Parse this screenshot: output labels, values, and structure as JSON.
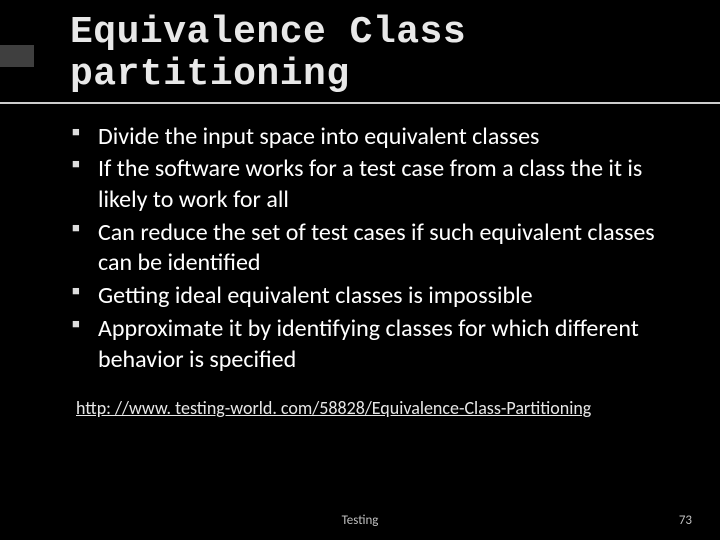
{
  "title": "Equivalence Class partitioning",
  "bullets": [
    "Divide the input space into equivalent classes",
    "If  the software works for a test case from a class the it is likely to work for all",
    "Can reduce the set of test cases if such equivalent classes can be identified",
    "Getting ideal  equivalent classes is  impossible",
    "Approximate it by identifying classes for which different behavior is specified"
  ],
  "link": "http: //www. testing-world. com/58828/Equivalence-Class-Partitioning",
  "footer": {
    "center": "Testing",
    "page": "73"
  }
}
